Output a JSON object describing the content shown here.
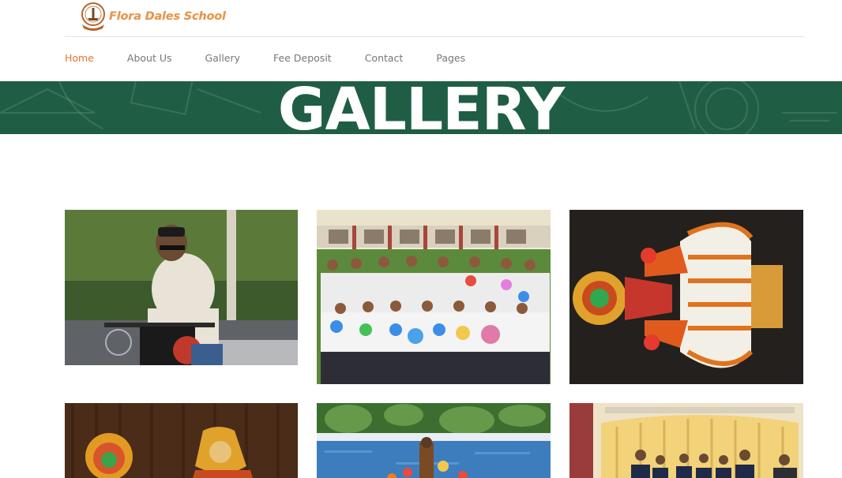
{
  "header": {
    "school_name": "Flora Dales School",
    "nav": [
      {
        "label": "Home",
        "active": true
      },
      {
        "label": "About Us",
        "active": false
      },
      {
        "label": "Gallery",
        "active": false
      },
      {
        "label": "Fee Deposit",
        "active": false
      },
      {
        "label": "Contact",
        "active": false
      },
      {
        "label": "Pages",
        "active": false
      }
    ]
  },
  "banner": {
    "title": "GALLERY",
    "background_color": "#1f5e45"
  },
  "colors": {
    "accent": "#e8732a",
    "logo_text": "#e8944a",
    "nav_text": "#777777"
  },
  "gallery": {
    "photos": [
      {
        "name": "boy-on-motorbike"
      },
      {
        "name": "students-with-paper-globes"
      },
      {
        "name": "kathakali-dancer"
      },
      {
        "name": "kathakali-stage-performance"
      },
      {
        "name": "poolside-activity"
      },
      {
        "name": "students-award-ceremony"
      }
    ]
  }
}
